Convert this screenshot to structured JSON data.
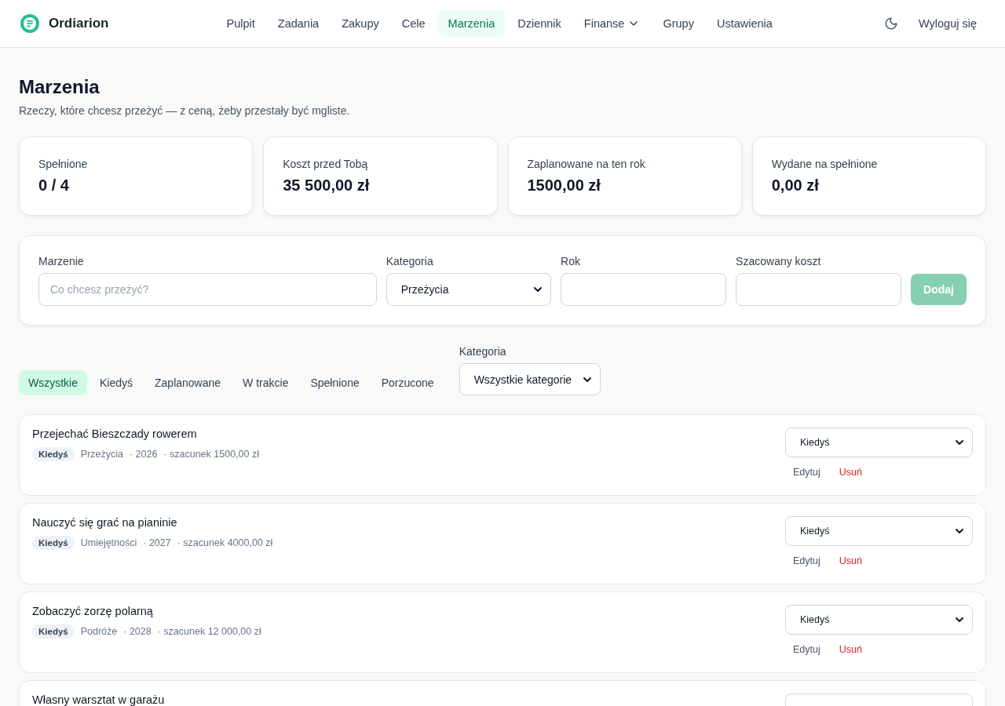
{
  "brand": {
    "name": "Ordiarion"
  },
  "nav": [
    {
      "label": "Pulpit",
      "selected": false,
      "dropdown": false
    },
    {
      "label": "Zadania",
      "selected": false,
      "dropdown": false
    },
    {
      "label": "Zakupy",
      "selected": false,
      "dropdown": false
    },
    {
      "label": "Cele",
      "selected": false,
      "dropdown": false
    },
    {
      "label": "Marzenia",
      "selected": true,
      "dropdown": false
    },
    {
      "label": "Dziennik",
      "selected": false,
      "dropdown": false
    },
    {
      "label": "Finanse",
      "selected": false,
      "dropdown": true
    },
    {
      "label": "Grupy",
      "selected": false,
      "dropdown": false
    },
    {
      "label": "Ustawienia",
      "selected": false,
      "dropdown": false
    }
  ],
  "logout": "Wyloguj się",
  "page": {
    "title": "Marzenia",
    "subtitle": "Rzeczy, które chcesz przeżyć — z ceną, żeby przestały być mgliste."
  },
  "stats": [
    {
      "label": "Spełnione",
      "value": "0 / 4"
    },
    {
      "label": "Koszt przed Tobą",
      "value": "35 500,00 zł"
    },
    {
      "label": "Zaplanowane na ten rok",
      "value": "1500,00 zł"
    },
    {
      "label": "Wydane na spełnione",
      "value": "0,00 zł"
    }
  ],
  "form": {
    "fields": [
      {
        "label": "Marzenie",
        "kind": "text",
        "placeholder": "Co chcesz przeżyć?"
      },
      {
        "label": "Kategoria",
        "kind": "select",
        "value": "Przeżycia"
      },
      {
        "label": "Rok",
        "kind": "text"
      },
      {
        "label": "Szacowany koszt",
        "kind": "text"
      }
    ],
    "submit": {
      "label": "Dodaj",
      "disabled": true
    }
  },
  "filters": {
    "tabs": [
      {
        "label": "Wszystkie",
        "selected": true
      },
      {
        "label": "Kiedyś",
        "selected": false
      },
      {
        "label": "Zaplanowane",
        "selected": false
      },
      {
        "label": "W trakcie",
        "selected": false
      },
      {
        "label": "Spełnione",
        "selected": false
      },
      {
        "label": "Porzucone",
        "selected": false
      }
    ],
    "category": {
      "label": "Kategoria",
      "value": "Wszystkie kategorie"
    }
  },
  "dreams": [
    {
      "title": "Przejechać Bieszczady rowerem",
      "status": "Kiedyś",
      "category": "Przeżycia",
      "year": "· 2026",
      "estimate": "· szacunek 1500,00 zł",
      "status_select": "Kiedyś",
      "edit": "Edytuj",
      "delete": "Usuń"
    },
    {
      "title": "Nauczyć się grać na pianinie",
      "status": "Kiedyś",
      "category": "Umiejętności",
      "year": "· 2027",
      "estimate": "· szacunek 4000,00 zł",
      "status_select": "Kiedyś",
      "edit": "Edytuj",
      "delete": "Usuń"
    },
    {
      "title": "Zobaczyć zorzę polarną",
      "status": "Kiedyś",
      "category": "Podróże",
      "year": "· 2028",
      "estimate": "· szacunek 12 000,00 zł",
      "status_select": "Kiedyś",
      "edit": "Edytuj",
      "delete": "Usuń"
    },
    {
      "title": "Własny warsztat w garażu"
    }
  ]
}
